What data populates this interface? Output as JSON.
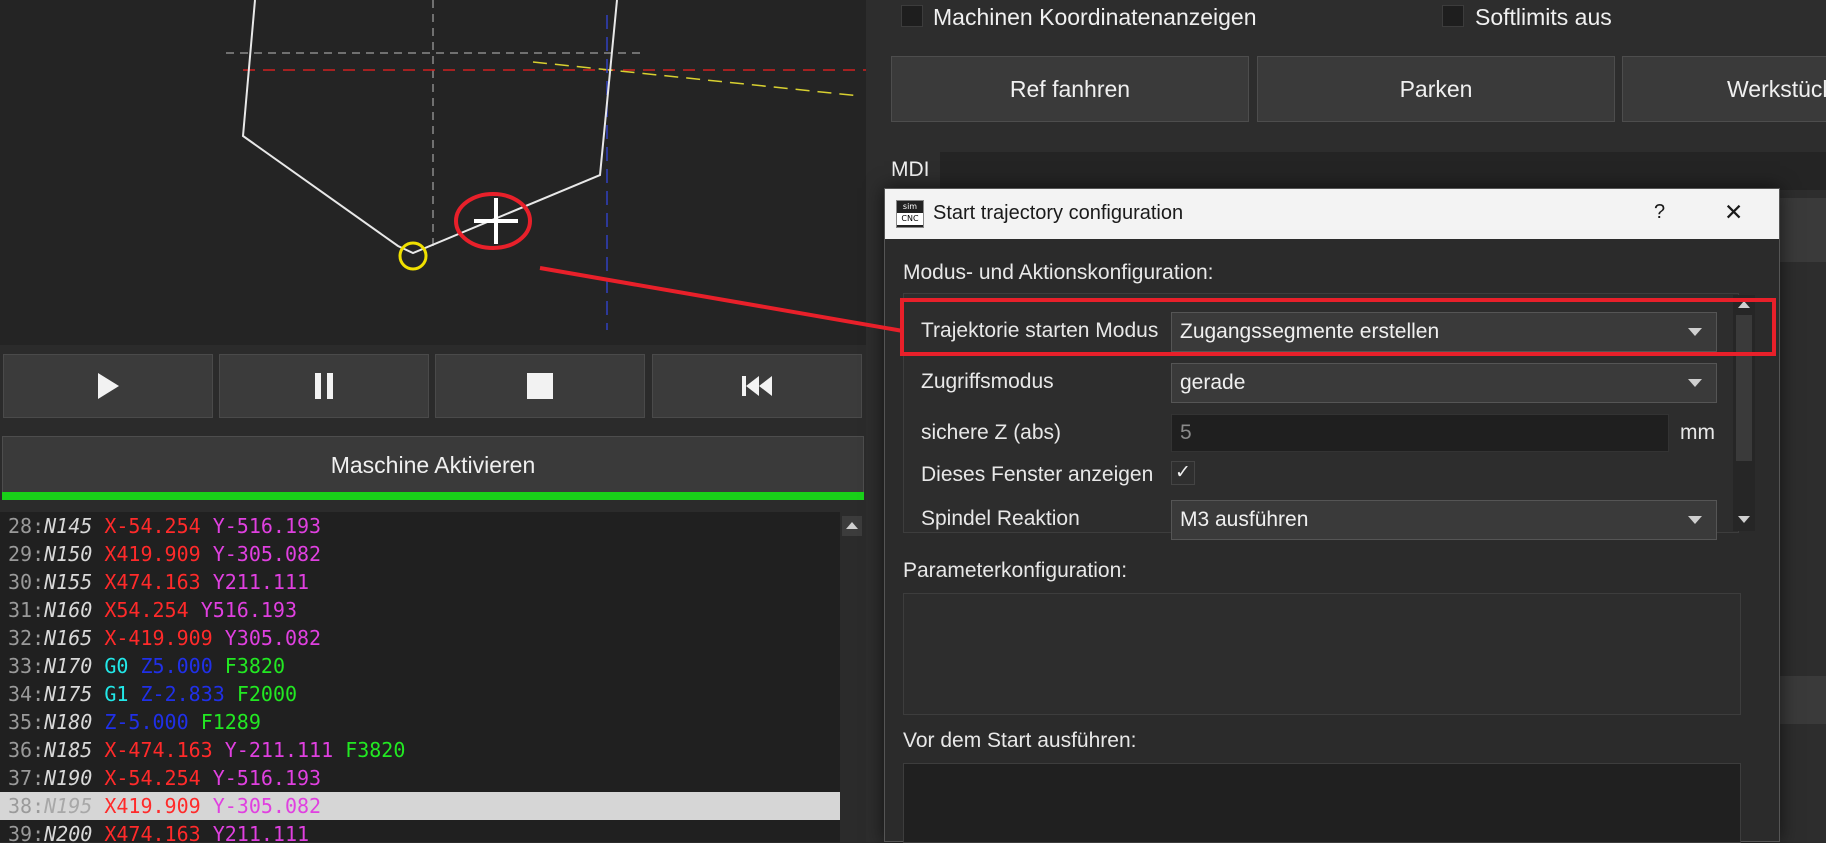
{
  "preview": {},
  "transport": {
    "buttons": [
      {
        "name": "play-icon"
      },
      {
        "name": "pause-icon"
      },
      {
        "name": "stop-icon"
      },
      {
        "name": "rewind-icon"
      }
    ]
  },
  "activate_button": "Maschine Aktivieren",
  "code_lines": [
    {
      "num": "28:",
      "n": "N145",
      "parts": [
        {
          "t": "X-54.254",
          "c": "#ff2a2a"
        },
        {
          "t": "Y-516.193",
          "c": "#e040e0"
        }
      ]
    },
    {
      "num": "29:",
      "n": "N150",
      "parts": [
        {
          "t": "X419.909",
          "c": "#ff2a2a"
        },
        {
          "t": "Y-305.082",
          "c": "#e040e0"
        }
      ]
    },
    {
      "num": "30:",
      "n": "N155",
      "parts": [
        {
          "t": "X474.163",
          "c": "#ff2a2a"
        },
        {
          "t": "Y211.111",
          "c": "#e040e0"
        }
      ]
    },
    {
      "num": "31:",
      "n": "N160",
      "parts": [
        {
          "t": "X54.254",
          "c": "#ff2a2a"
        },
        {
          "t": "Y516.193",
          "c": "#e040e0"
        }
      ]
    },
    {
      "num": "32:",
      "n": "N165",
      "parts": [
        {
          "t": "X-419.909",
          "c": "#ff2a2a"
        },
        {
          "t": "Y305.082",
          "c": "#e040e0"
        }
      ]
    },
    {
      "num": "33:",
      "n": "N170",
      "parts": [
        {
          "t": "G0",
          "c": "#22e8e8"
        },
        {
          "t": "Z5.000",
          "c": "#2030e8"
        },
        {
          "t": "F3820",
          "c": "#22e822"
        }
      ]
    },
    {
      "num": "34:",
      "n": "N175",
      "parts": [
        {
          "t": "G1",
          "c": "#22e8e8"
        },
        {
          "t": "Z-2.833",
          "c": "#2030e8"
        },
        {
          "t": "F2000",
          "c": "#22e822"
        }
      ]
    },
    {
      "num": "35:",
      "n": "N180",
      "parts": [
        {
          "t": "Z-5.000",
          "c": "#2030e8"
        },
        {
          "t": "F1289",
          "c": "#22e822"
        }
      ]
    },
    {
      "num": "36:",
      "n": "N185",
      "parts": [
        {
          "t": "X-474.163",
          "c": "#ff2a2a"
        },
        {
          "t": "Y-211.111",
          "c": "#e040e0"
        },
        {
          "t": "F3820",
          "c": "#22e822"
        }
      ]
    },
    {
      "num": "37:",
      "n": "N190",
      "parts": [
        {
          "t": "X-54.254",
          "c": "#ff2a2a"
        },
        {
          "t": "Y-516.193",
          "c": "#e040e0"
        }
      ]
    },
    {
      "num": "38:",
      "n": "N195",
      "parts": [
        {
          "t": "X419.909",
          "c": "#ff2a2a"
        },
        {
          "t": "Y-305.082",
          "c": "#e040e0"
        }
      ],
      "selected": true
    },
    {
      "num": "39:",
      "n": "N200",
      "parts": [
        {
          "t": "X474.163",
          "c": "#ff2a2a"
        },
        {
          "t": "Y211.111",
          "c": "#e040e0"
        }
      ]
    }
  ],
  "right": {
    "checkbox_machine_coords": "Machinen Koordinatenanzeigen",
    "checkbox_softlimits": "Softlimits aus",
    "btn_ref": "Ref fanhren",
    "btn_park": "Parken",
    "btn_workpiece": "Werkstück",
    "mdi_label": "MDI"
  },
  "dialog": {
    "title": "Start trajectory configuration",
    "logo_top": "sim",
    "logo_bottom": "CNC",
    "help": "?",
    "close": "✕",
    "section_mode": "Modus- und Aktionskonfiguration:",
    "rows": {
      "mode_label": "Trajektorie starten Modus",
      "mode_value": "Zugangssegmente erstellen",
      "access_label": "Zugriffsmodus",
      "access_value": "gerade",
      "safez_label": "sichere Z (abs)",
      "safez_value": "5",
      "safez_unit": "mm",
      "show_label": "Dieses Fenster anzeigen",
      "show_check": "✓",
      "spindle_label": "Spindel Reaktion",
      "spindle_value": "M3 ausführen"
    },
    "section_params": "Parameterkonfiguration:",
    "section_before": "Vor dem Start ausführen:"
  },
  "colors": {
    "annotation_red": "#e8202a",
    "annotation_yellow": "#f0e000",
    "progress_green": "#19d019"
  }
}
